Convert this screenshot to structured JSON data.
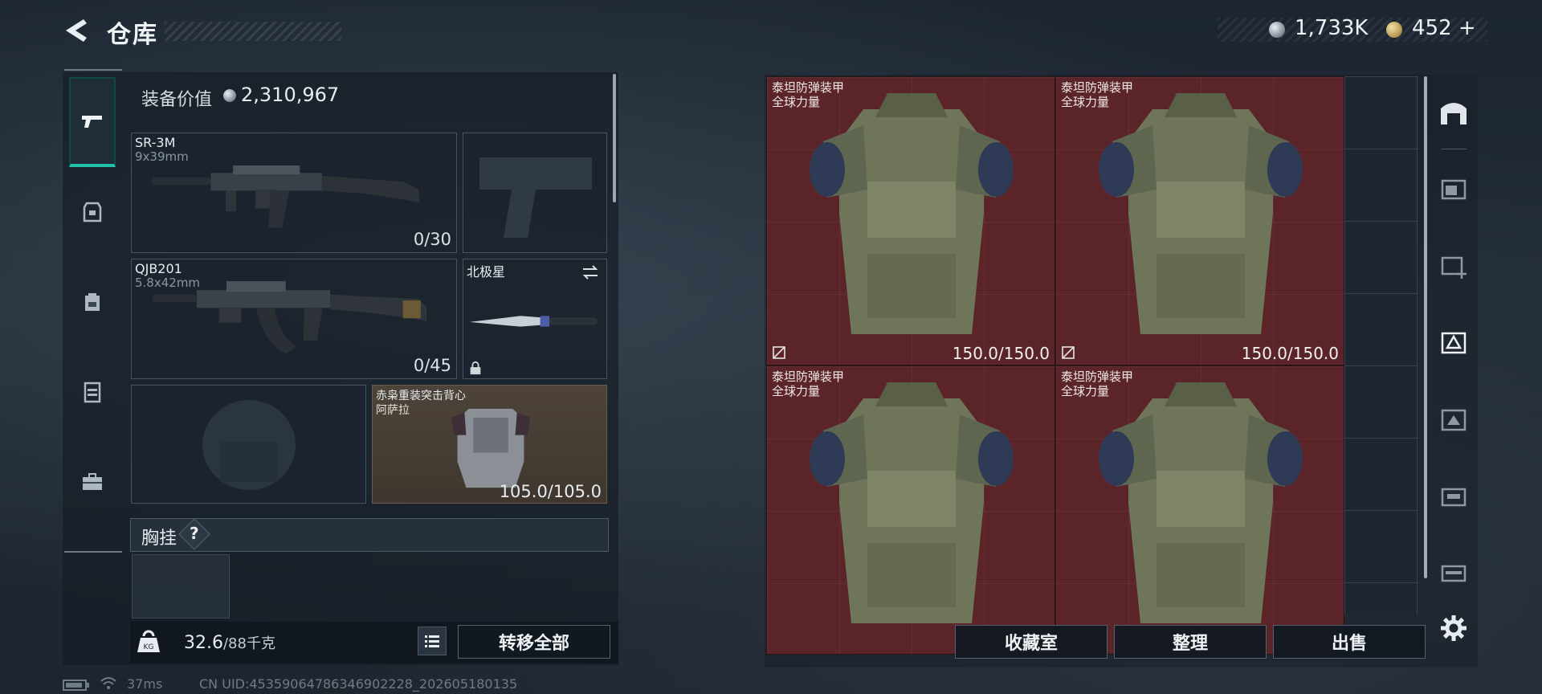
{
  "header": {
    "title": "仓库",
    "back_icon": "back-arrow-icon"
  },
  "currency": {
    "primary": "1,733K",
    "secondary": "452",
    "secondary_add": "+"
  },
  "loadout": {
    "value_label": "装备价值",
    "value": "2,310,967",
    "tabs": [
      {
        "icon": "pistol-icon",
        "active": true
      },
      {
        "icon": "armor-tab-icon"
      },
      {
        "icon": "backpack-icon"
      },
      {
        "icon": "chest-rig-icon"
      },
      {
        "icon": "toolbox-icon"
      }
    ],
    "primary_weapon": {
      "name": "SR-3M",
      "caliber": "9x39mm",
      "ammo": "0/30"
    },
    "secondary_weapon": {
      "name": "QJB201",
      "caliber": "5.8x42mm",
      "ammo": "0/45"
    },
    "melee": {
      "name": "北极星",
      "swap_icon": "swap-icon",
      "lock_icon": "lock-icon"
    },
    "armor": {
      "name": "赤枭重装突击背心",
      "brand": "阿萨拉",
      "durability": "105.0/105.0"
    },
    "chest_rig": {
      "label": "胸挂",
      "help": "?"
    },
    "weight": {
      "current": "32.6",
      "max": "/88千克"
    },
    "move_all": "转移全部"
  },
  "storage": {
    "items": [
      {
        "name": "泰坦防弹装甲",
        "brand": "全球力量",
        "durability": "150.0/150.0"
      },
      {
        "name": "泰坦防弹装甲",
        "brand": "全球力量",
        "durability": "150.0/150.0"
      },
      {
        "name": "泰坦防弹装甲",
        "brand": "全球力量",
        "durability": ""
      },
      {
        "name": "泰坦防弹装甲",
        "brand": "全球力量",
        "durability": ""
      }
    ],
    "buttons": {
      "collection": "收藏室",
      "sort": "整理",
      "sell": "出售"
    },
    "accent": "#5b2429"
  },
  "status": {
    "ping": "37ms",
    "uid": "CN UID:45359064786346902228_202605180135"
  }
}
